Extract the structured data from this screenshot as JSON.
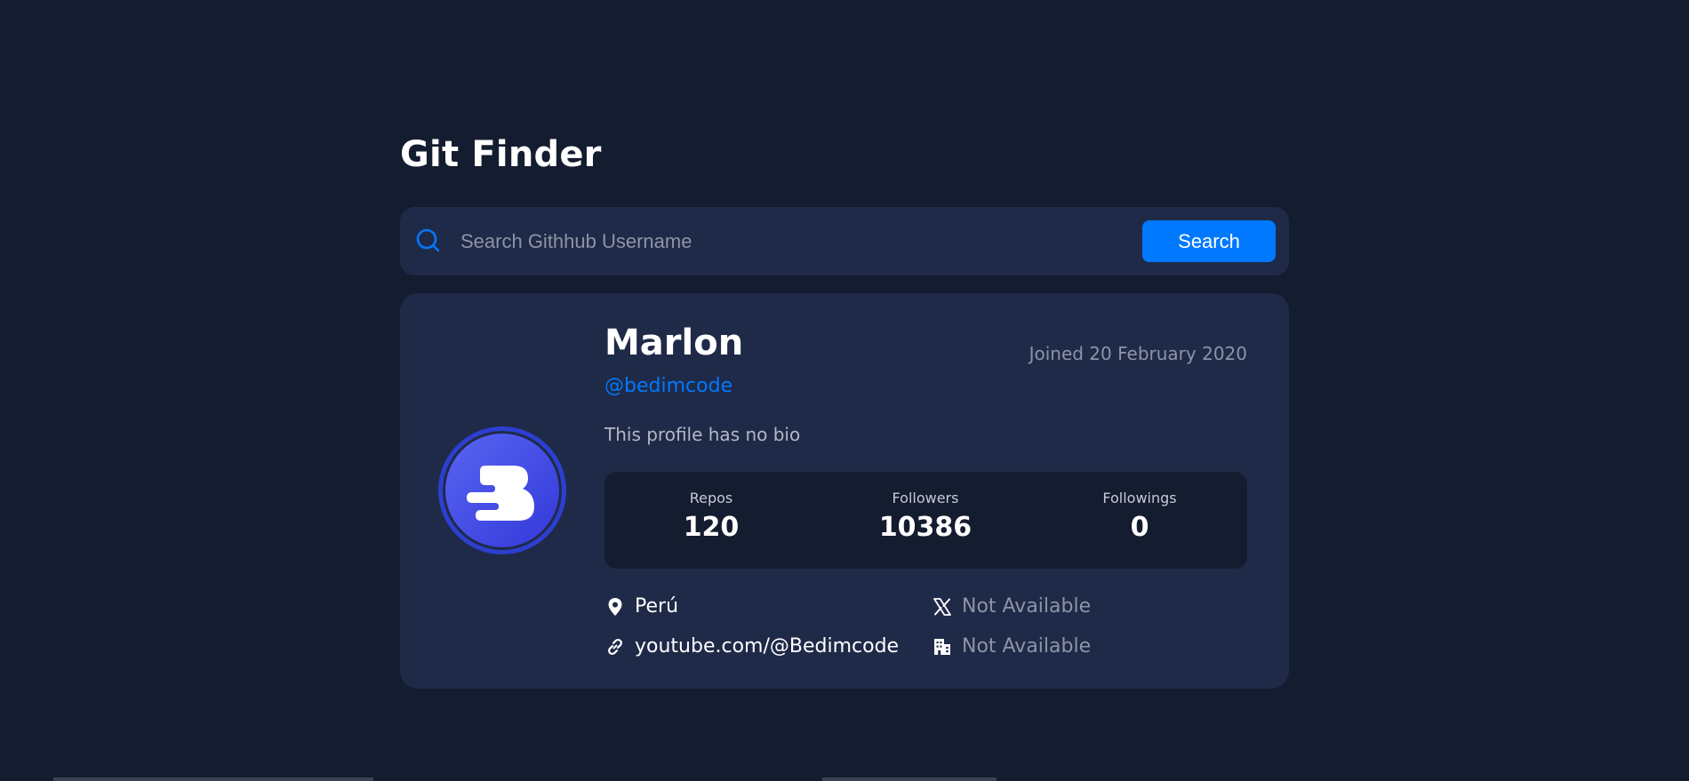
{
  "app": {
    "title": "Git Finder"
  },
  "search": {
    "placeholder": "Search Githhub Username",
    "value": "",
    "button_label": "Search"
  },
  "profile": {
    "name": "Marlon",
    "joined": "Joined 20 February 2020",
    "handle": "@bedimcode",
    "bio": "This profile has no bio",
    "avatar_icon": "bedimcode-logo-avatar"
  },
  "stats": [
    {
      "label": "Repos",
      "value": "120"
    },
    {
      "label": "Followers",
      "value": "10386"
    },
    {
      "label": "Followings",
      "value": "0"
    }
  ],
  "links": {
    "location": {
      "icon": "location-pin-icon",
      "text": "Perú"
    },
    "blog": {
      "icon": "link-icon",
      "text": "youtube.com/@Bedimcode"
    },
    "twitter": {
      "icon": "x-logo-icon",
      "text": "Not Available"
    },
    "company": {
      "icon": "building-icon",
      "text": "Not Available"
    }
  },
  "colors": {
    "background": "#141c2f",
    "card": "#1f2a48",
    "accent": "#0079ff",
    "muted": "#8d94a6",
    "avatar": "#4a5aef"
  }
}
